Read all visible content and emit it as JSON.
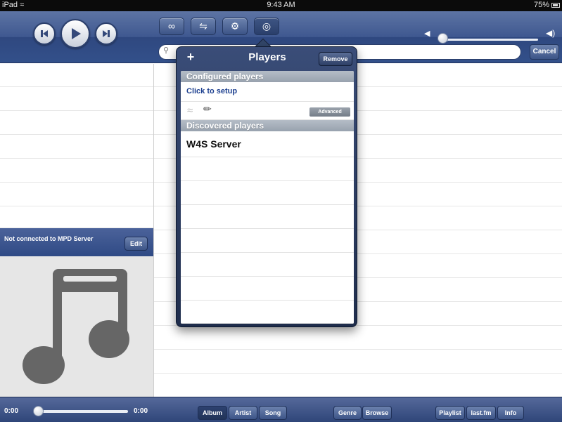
{
  "status_bar": {
    "device": "iPad",
    "time": "9:43 AM",
    "battery": "75%"
  },
  "search": {
    "placeholder": ""
  },
  "toolbar": {
    "cancel_label": "Cancel"
  },
  "status": {
    "text": "Not connected to MPD Server",
    "edit_label": "Edit"
  },
  "progress": {
    "elapsed": "0:00",
    "remaining": "0:00",
    "fraction": 0.0
  },
  "volume": {
    "fraction": 0.05
  },
  "tabs": [
    {
      "label": "Album",
      "active": true
    },
    {
      "label": "Artist",
      "active": false
    },
    {
      "label": "Song",
      "active": false
    },
    {
      "label": "Genre",
      "active": false
    },
    {
      "label": "Browse",
      "active": false
    },
    {
      "label": "Playlist",
      "active": false
    },
    {
      "label": "last.fm",
      "active": false
    },
    {
      "label": "Info",
      "active": false
    }
  ],
  "popover": {
    "title": "Players",
    "remove_label": "Remove",
    "add_label": "+",
    "configured_header": "Configured players",
    "setup_link": "Click to setup",
    "advanced_label": "Advanced",
    "discovered_header": "Discovered players",
    "players": [
      "W4S Server"
    ]
  },
  "colors": {
    "bar_blue": "#33508a",
    "link_blue": "#1c3f8f",
    "section_gray": "#a7afba"
  }
}
